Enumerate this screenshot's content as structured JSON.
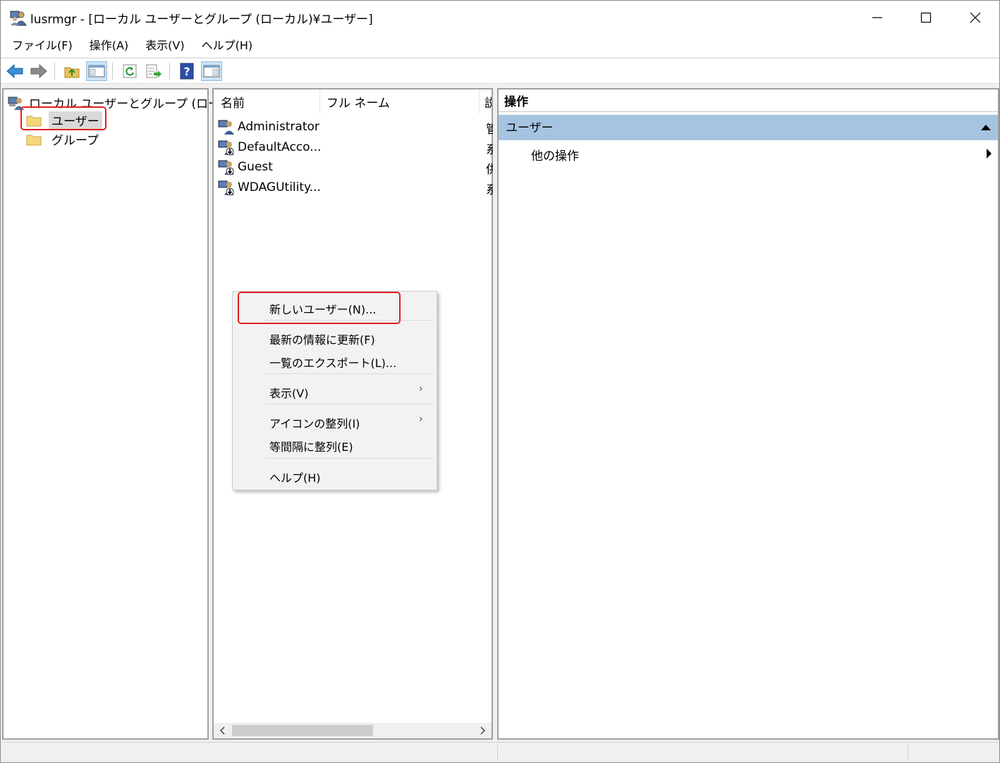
{
  "window": {
    "title": "lusrmgr - [ローカル ユーザーとグループ (ローカル)¥ユーザー]"
  },
  "menubar": {
    "items": [
      "ファイル(F)",
      "操作(A)",
      "表示(V)",
      "ヘルプ(H)"
    ]
  },
  "toolbar": {
    "buttons": [
      "back-arrow-icon",
      "forward-arrow-icon",
      "up-folder-icon",
      "show-hide-tree-icon",
      "refresh-icon",
      "export-list-icon",
      "help-icon",
      "show-hide-action-pane-icon"
    ]
  },
  "tree": {
    "root_label": "ローカル ユーザーとグループ (ローカル)",
    "nodes": [
      {
        "label": "ユーザー",
        "selected": true
      },
      {
        "label": "グループ",
        "selected": false
      }
    ]
  },
  "list": {
    "columns": [
      "名前",
      "フル ネーム",
      "説"
    ],
    "rows": [
      {
        "name": "Administrator",
        "desc": "管"
      },
      {
        "name": "DefaultAcco...",
        "desc": "系"
      },
      {
        "name": "Guest",
        "desc": "供"
      },
      {
        "name": "WDAGUtility...",
        "desc": "系"
      }
    ]
  },
  "actions": {
    "header": "操作",
    "section": "ユーザー",
    "item": "他の操作"
  },
  "context_menu": {
    "items": [
      {
        "label": "新しいユーザー(N)...",
        "submenu": false
      },
      {
        "label": "最新の情報に更新(F)",
        "submenu": false
      },
      {
        "label": "一覧のエクスポート(L)...",
        "submenu": false
      },
      {
        "label": "表示(V)",
        "submenu": true
      },
      {
        "label": "アイコンの整列(I)",
        "submenu": true
      },
      {
        "label": "等間隔に整列(E)",
        "submenu": false
      },
      {
        "label": "ヘルプ(H)",
        "submenu": false
      }
    ],
    "submenu_arrow": "›"
  },
  "colors": {
    "highlight": "#e02020",
    "action_section_bg": "#a6c4e2",
    "selection_bg": "#d9d9d9"
  }
}
